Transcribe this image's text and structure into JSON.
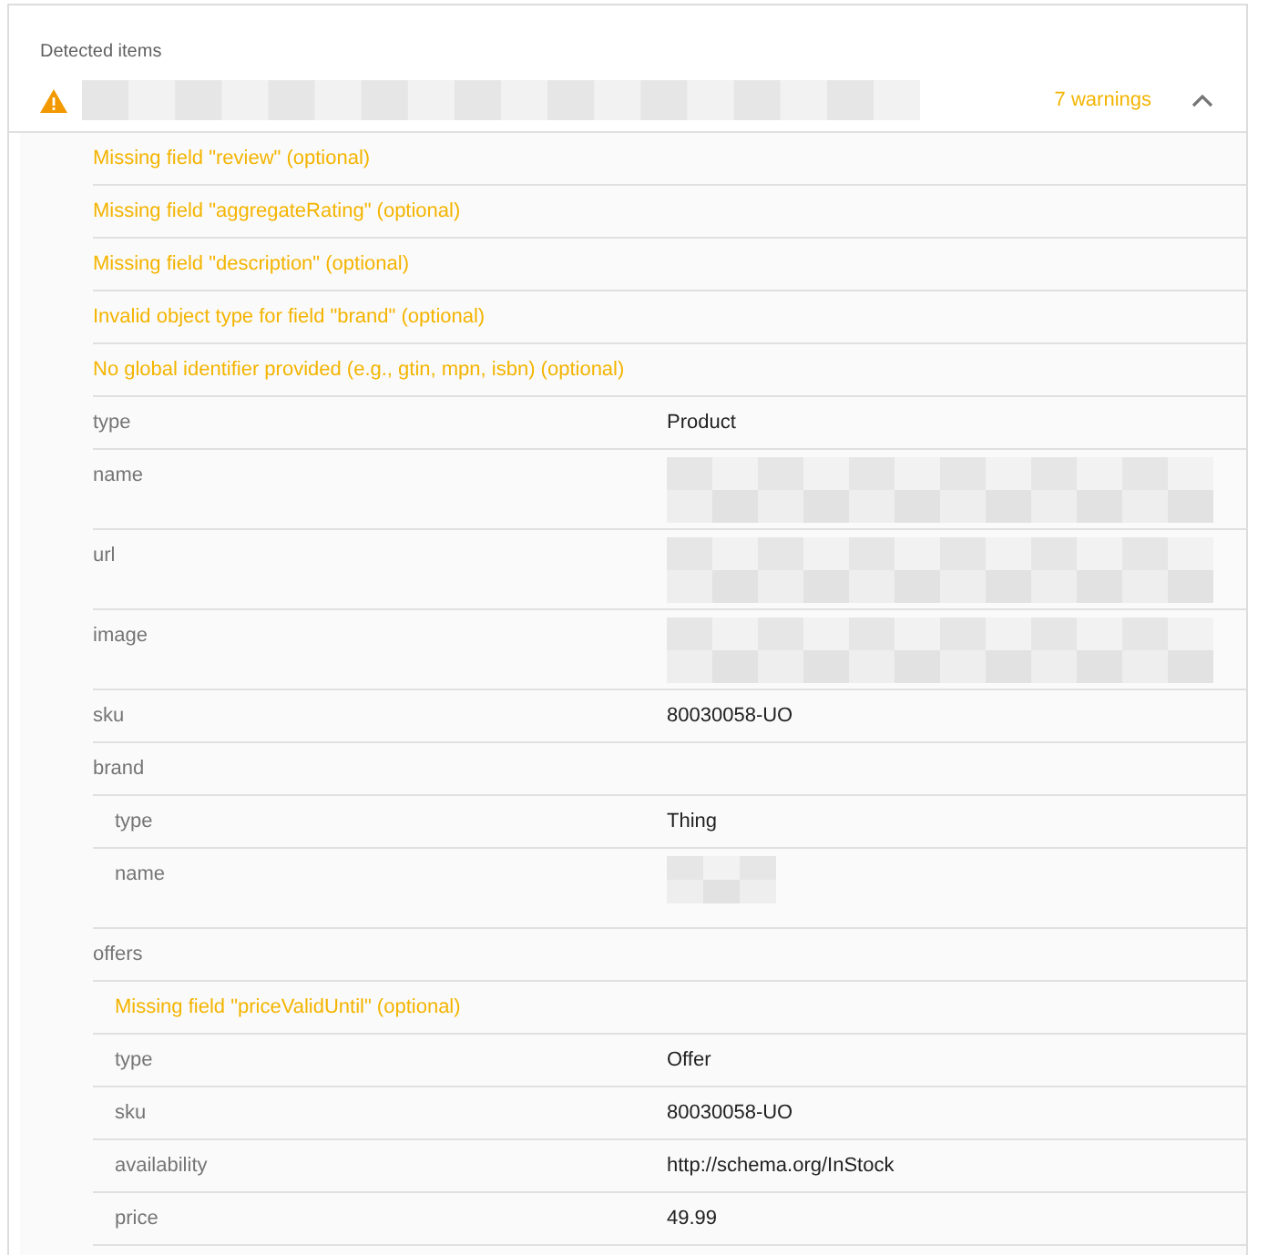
{
  "section_title": "Detected items",
  "item": {
    "warnings_count": "7 warnings",
    "expanded": true,
    "warnings": [
      "Missing field \"review\" (optional)",
      "Missing field \"aggregateRating\" (optional)",
      "Missing field \"description\" (optional)",
      "Invalid object type for field \"brand\" (optional)",
      "No global identifier provided (e.g., gtin, mpn, isbn) (optional)"
    ],
    "properties": [
      {
        "label": "type",
        "value": "Product"
      },
      {
        "label": "name",
        "kind": "picture"
      },
      {
        "label": "url",
        "kind": "picture"
      },
      {
        "label": "image",
        "kind": "picture"
      },
      {
        "label": "sku",
        "value": "80030058-UO"
      },
      {
        "label": "brand",
        "children": [
          {
            "label": "type",
            "value": "Thing"
          },
          {
            "label": "name",
            "kind": "picture"
          }
        ]
      },
      {
        "label": "offers",
        "warnings": [
          "Missing field \"priceValidUntil\" (optional)"
        ],
        "children": [
          {
            "label": "type",
            "value": "Offer"
          },
          {
            "label": "sku",
            "value": "80030058-UO"
          },
          {
            "label": "availability",
            "value": "http://schema.org/InStock"
          },
          {
            "label": "price",
            "value": "49.99"
          }
        ]
      }
    ]
  }
}
